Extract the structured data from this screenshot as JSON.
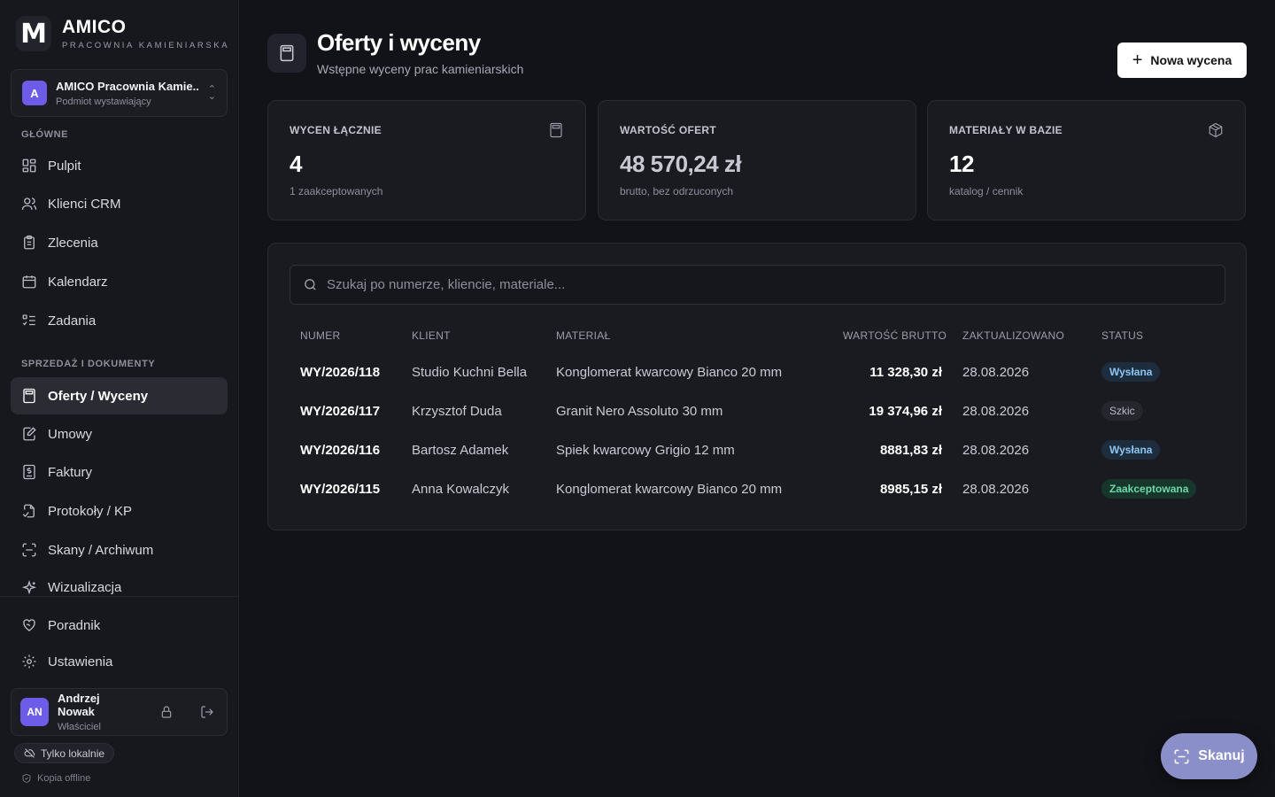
{
  "brand": {
    "name": "AMICO",
    "subtitle": "PRACOWNIA KAMIENIARSKA",
    "mark": "M"
  },
  "entity": {
    "initial": "A",
    "name": "AMICO Pracownia Kamie...",
    "role": "Podmiot wystawiający"
  },
  "nav": {
    "section_main": "GŁÓWNE",
    "section_sales": "SPRZEDAŻ I DOKUMENTY",
    "items": [
      {
        "label": "Pulpit",
        "icon": "dashboard-icon"
      },
      {
        "label": "Klienci CRM",
        "icon": "users-icon"
      },
      {
        "label": "Zlecenia",
        "icon": "clipboard-icon"
      },
      {
        "label": "Kalendarz",
        "icon": "calendar-icon"
      },
      {
        "label": "Zadania",
        "icon": "tasks-icon"
      },
      {
        "label": "Oferty / Wyceny",
        "icon": "calculator-icon"
      },
      {
        "label": "Umowy",
        "icon": "contract-icon"
      },
      {
        "label": "Faktury",
        "icon": "invoice-icon"
      },
      {
        "label": "Protokoły / KP",
        "icon": "protocol-icon"
      },
      {
        "label": "Skany / Archiwum",
        "icon": "scan-icon"
      },
      {
        "label": "Wizualizacja",
        "icon": "sparkle-icon"
      },
      {
        "label": "Poradnik",
        "icon": "heart-hand-icon"
      },
      {
        "label": "Ustawienia",
        "icon": "gear-icon"
      }
    ]
  },
  "user": {
    "initials": "AN",
    "name": "Andrzej Nowak",
    "role": "Właściciel"
  },
  "local_mode": "Tylko lokalnie",
  "offline_note": "Kopia offline",
  "header": {
    "title": "Oferty i wyceny",
    "subtitle": "Wstępne wyceny prac kamieniarskich",
    "new_button": "Nowa wycena"
  },
  "stats": [
    {
      "label": "WYCEN ŁĄCZNIE",
      "value": "4",
      "note": "1 zaakceptowanych"
    },
    {
      "label": "WARTOŚĆ OFERT",
      "value": "48 570,24 zł",
      "note": "brutto, bez odrzuconych"
    },
    {
      "label": "MATERIAŁY W BAZIE",
      "value": "12",
      "note": "katalog / cennik"
    }
  ],
  "search": {
    "placeholder": "Szukaj po numerze, kliencie, materiale..."
  },
  "table": {
    "columns": [
      "NUMER",
      "KLIENT",
      "MATERIAŁ",
      "WARTOŚĆ BRUTTO",
      "ZAKTUALIZOWANO",
      "STATUS"
    ],
    "rows": [
      {
        "number": "WY/2026/118",
        "client": "Studio Kuchni Bella",
        "material": "Konglomerat kwarcowy Bianco 20 mm",
        "amount": "11 328,30 zł",
        "updated": "28.08.2026",
        "status": "Wysłana"
      },
      {
        "number": "WY/2026/117",
        "client": "Krzysztof Duda",
        "material": "Granit Nero Assoluto 30 mm",
        "amount": "19 374,96 zł",
        "updated": "28.08.2026",
        "status": "Szkic"
      },
      {
        "number": "WY/2026/116",
        "client": "Bartosz Adamek",
        "material": "Spiek kwarcowy Grigio 12 mm",
        "amount": "8881,83 zł",
        "updated": "28.08.2026",
        "status": "Wysłana"
      },
      {
        "number": "WY/2026/115",
        "client": "Anna Kowalczyk",
        "material": "Konglomerat kwarcowy Bianco 20 mm",
        "amount": "8985,15 zł",
        "updated": "28.08.2026",
        "status": "Zaakceptowana"
      }
    ]
  },
  "scan_button": "Skanuj"
}
